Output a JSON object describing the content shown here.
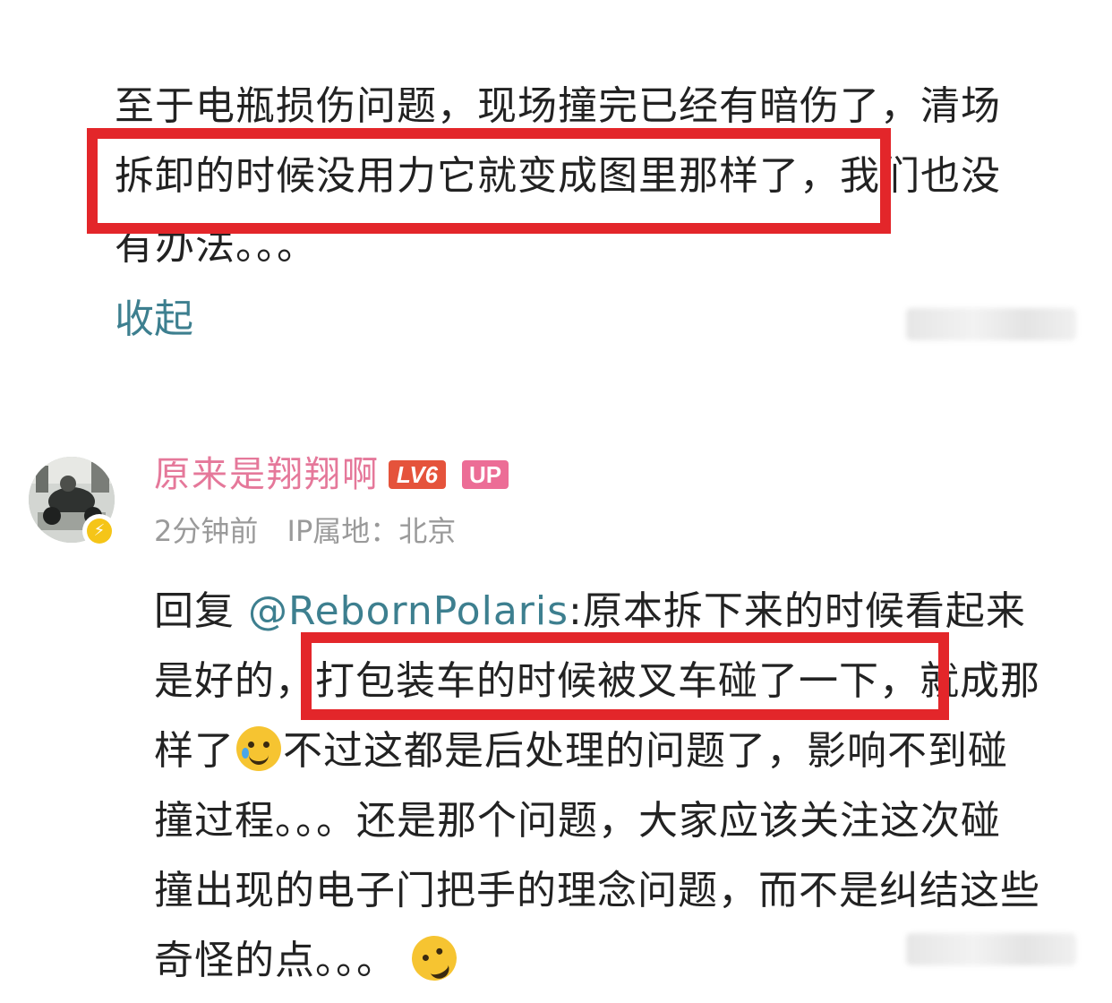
{
  "first_comment": {
    "lines": [
      "至于电瓶损伤问题，现场撞完已经有暗伤了，清场",
      "拆卸的时候没用力它就变成图里那样了，我们也没",
      "有办法。。。"
    ],
    "collapse_label": "收起"
  },
  "reply": {
    "username": "原来是翔翔啊",
    "level_badge": "LV6",
    "up_badge": "UP",
    "time": "2分钟前",
    "ip_location": "IP属地：北京",
    "reply_prefix": "回复",
    "mention": "@RebornPolaris",
    "lines": {
      "l1_rest": ":原本拆下来的时候看起来",
      "l2": "是好的，打包装车的时候被叉车碰了一下，就成那",
      "l3_a": "样了",
      "l3_b": "不过这都是后处理的问题了，影响不到碰",
      "l4": "撞过程。。。还是那个问题，大家应该关注这次碰",
      "l5": "撞出现的电子门把手的理念问题，而不是纠结这些",
      "l6": "奇怪的点。。。"
    },
    "emoji_1": "crying-smile-emoji",
    "emoji_2": "rolling-laughing-emoji"
  },
  "colors": {
    "highlight_box": "#e3262a",
    "username": "#e5789a",
    "link": "#3d7f8f",
    "meta_text": "#9a9a9a"
  }
}
